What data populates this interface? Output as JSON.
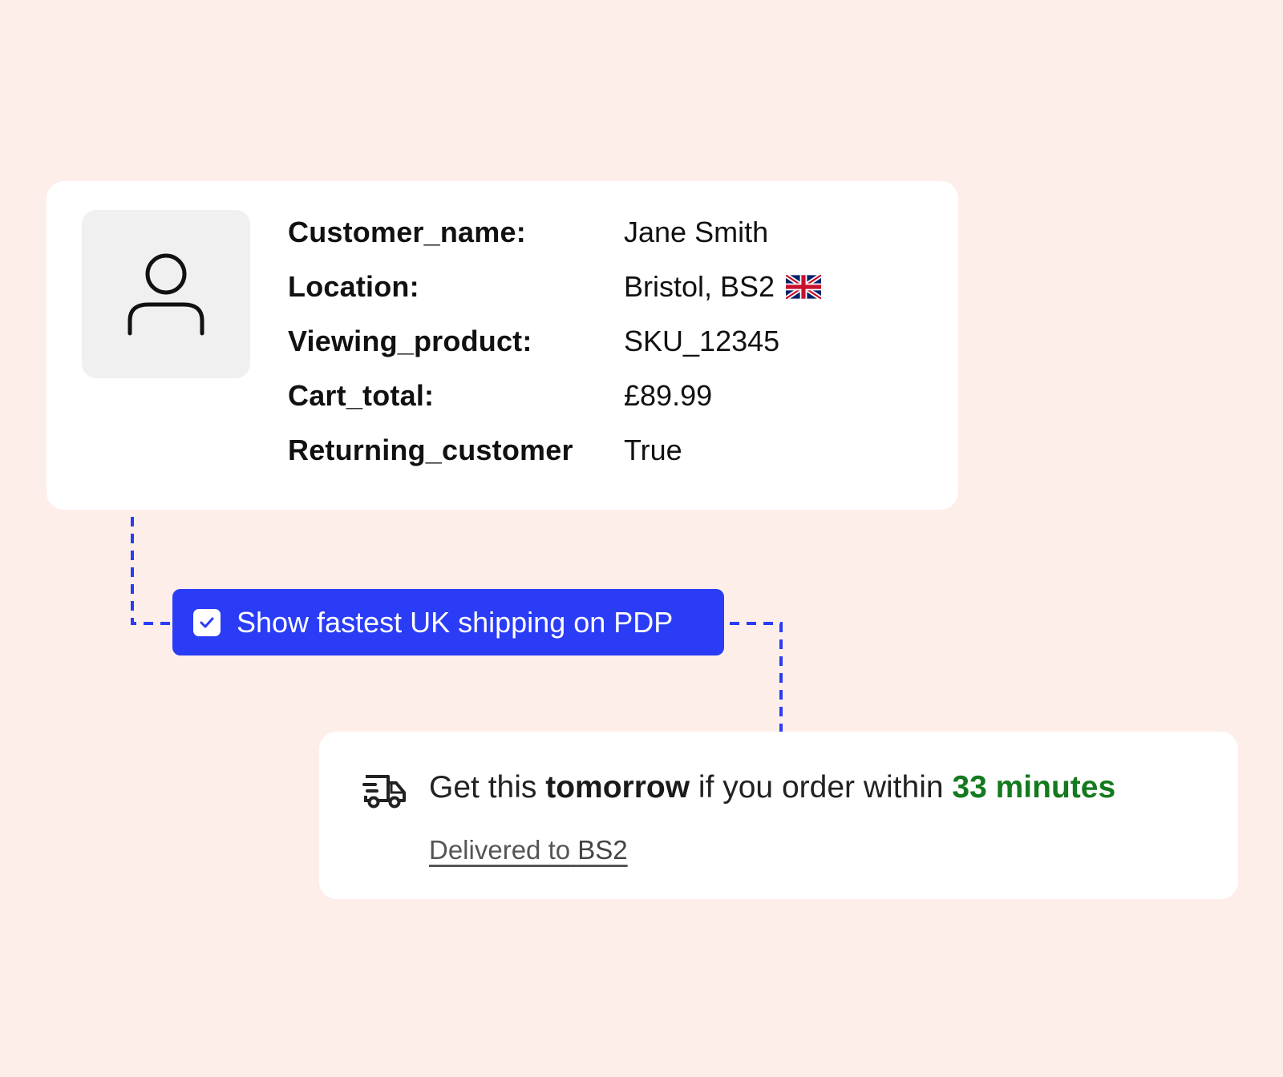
{
  "customer": {
    "attributes": [
      {
        "key": "Customer_name:",
        "value": "Jane Smith"
      },
      {
        "key": "Location:",
        "value": "Bristol, BS2"
      },
      {
        "key": "Viewing_product:",
        "value": "SKU_12345"
      },
      {
        "key": "Cart_total:",
        "value": "£89.99"
      },
      {
        "key": "Returning_customer",
        "value": "True"
      }
    ],
    "avatar_icon": "user-icon",
    "flag_icon": "uk-flag-icon"
  },
  "rule": {
    "checked": true,
    "label": "Show fastest UK shipping on PDP"
  },
  "shipping": {
    "icon": "delivery-truck-icon",
    "prefix": "Get this",
    "emphasis": "tomorrow",
    "middle": "if you order within",
    "time": "33 minutes",
    "delivered_prefix": "Delivered to",
    "delivered_postcode": "BS2"
  },
  "colors": {
    "background": "#fdeeea",
    "accent_blue": "#2a3cf5",
    "success_green": "#137a1e",
    "card": "#ffffff"
  }
}
